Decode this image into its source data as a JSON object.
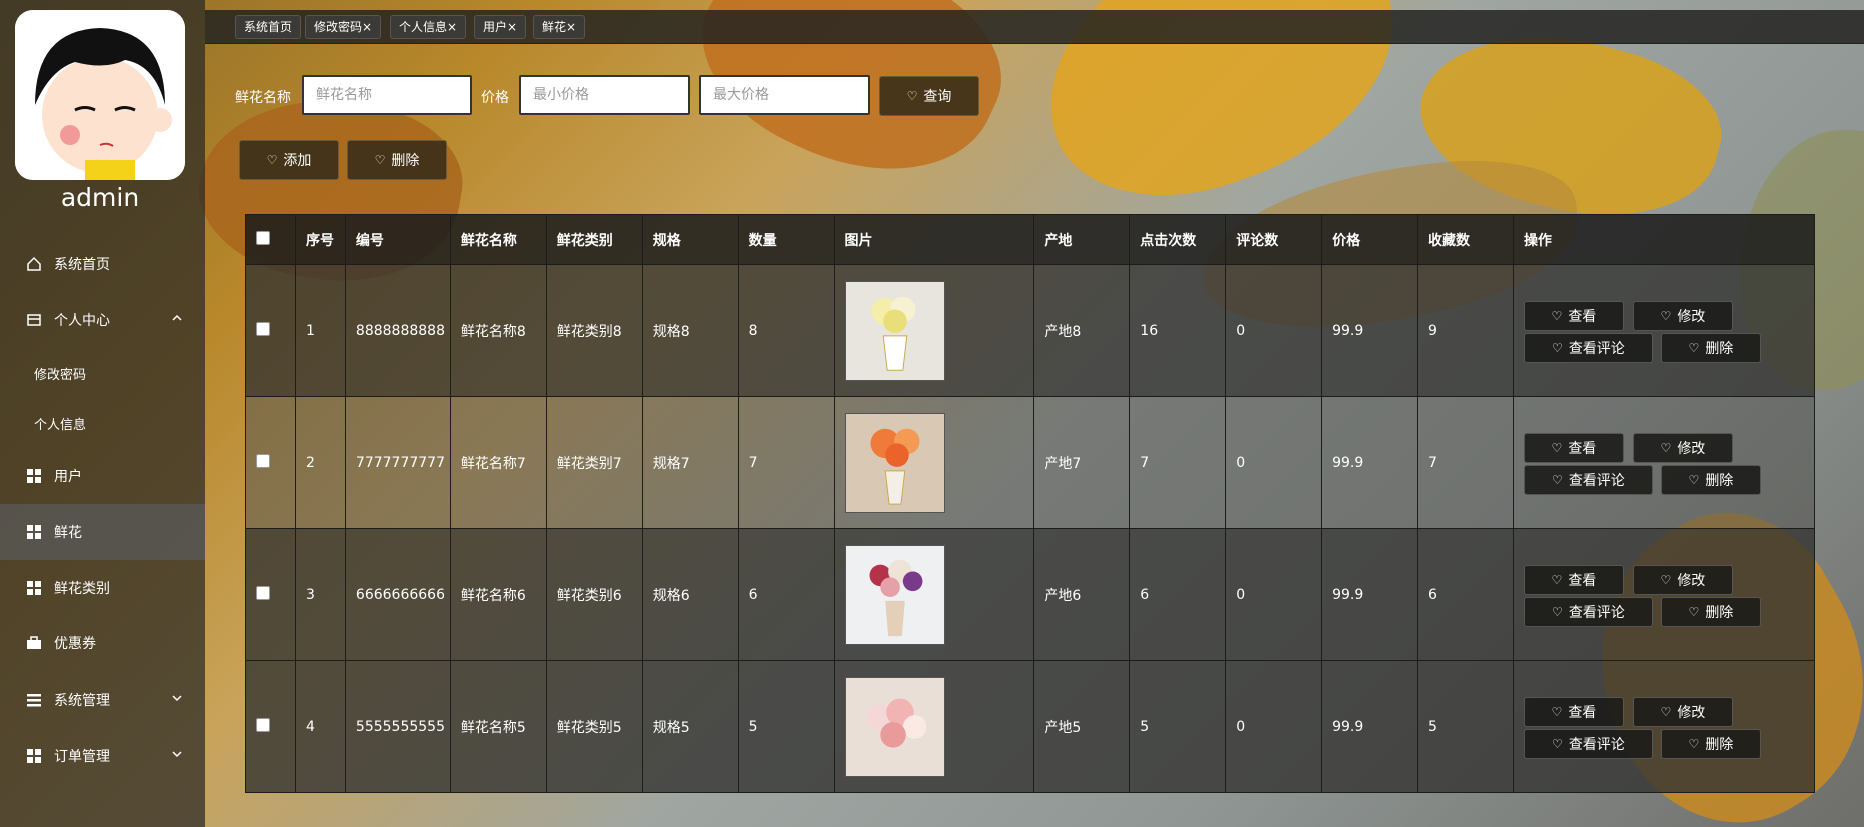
{
  "sidebar": {
    "username": "admin",
    "items": [
      {
        "label": "系统首页",
        "icon": "home-icon"
      },
      {
        "label": "个人中心",
        "icon": "profile-icon"
      },
      {
        "label": "修改密码"
      },
      {
        "label": "个人信息"
      },
      {
        "label": "用户",
        "icon": "grid-icon"
      },
      {
        "label": "鲜花",
        "icon": "grid-icon"
      },
      {
        "label": "鲜花类别",
        "icon": "grid-icon"
      },
      {
        "label": "优惠券",
        "icon": "briefcase-icon"
      },
      {
        "label": "系统管理",
        "icon": "list-icon"
      },
      {
        "label": "订单管理",
        "icon": "grid-icon"
      }
    ]
  },
  "tabs": [
    "系统首页",
    "修改密码×",
    "个人信息×",
    "用户×",
    "鲜花×"
  ],
  "search": {
    "name_label": "鲜花名称",
    "name_placeholder": "鲜花名称",
    "price_label": "价格",
    "min_placeholder": "最小价格",
    "max_placeholder": "最大价格",
    "query_button": "查询"
  },
  "toolbar": {
    "add": "添加",
    "delete": "删除"
  },
  "table": {
    "headers": [
      "序号",
      "编号",
      "鲜花名称",
      "鲜花类别",
      "规格",
      "数量",
      "图片",
      "产地",
      "点击次数",
      "评论数",
      "价格",
      "收藏数",
      "操作"
    ],
    "rows": [
      {
        "idx": "1",
        "code": "8888888888",
        "name": "鲜花名称8",
        "category": "鲜花类别8",
        "spec": "规格8",
        "qty": "8",
        "origin": "产地8",
        "clicks": "16",
        "comments": "0",
        "price": "99.9",
        "favorites": "9"
      },
      {
        "idx": "2",
        "code": "7777777777",
        "name": "鲜花名称7",
        "category": "鲜花类别7",
        "spec": "规格7",
        "qty": "7",
        "origin": "产地7",
        "clicks": "7",
        "comments": "0",
        "price": "99.9",
        "favorites": "7"
      },
      {
        "idx": "3",
        "code": "6666666666",
        "name": "鲜花名称6",
        "category": "鲜花类别6",
        "spec": "规格6",
        "qty": "6",
        "origin": "产地6",
        "clicks": "6",
        "comments": "0",
        "price": "99.9",
        "favorites": "6"
      },
      {
        "idx": "4",
        "code": "5555555555",
        "name": "鲜花名称5",
        "category": "鲜花类别5",
        "spec": "规格5",
        "qty": "5",
        "origin": "产地5",
        "clicks": "5",
        "comments": "0",
        "price": "99.9",
        "favorites": "5"
      }
    ],
    "actions": {
      "view": "查看",
      "edit": "修改",
      "comments": "查看评论",
      "delete": "删除"
    }
  }
}
